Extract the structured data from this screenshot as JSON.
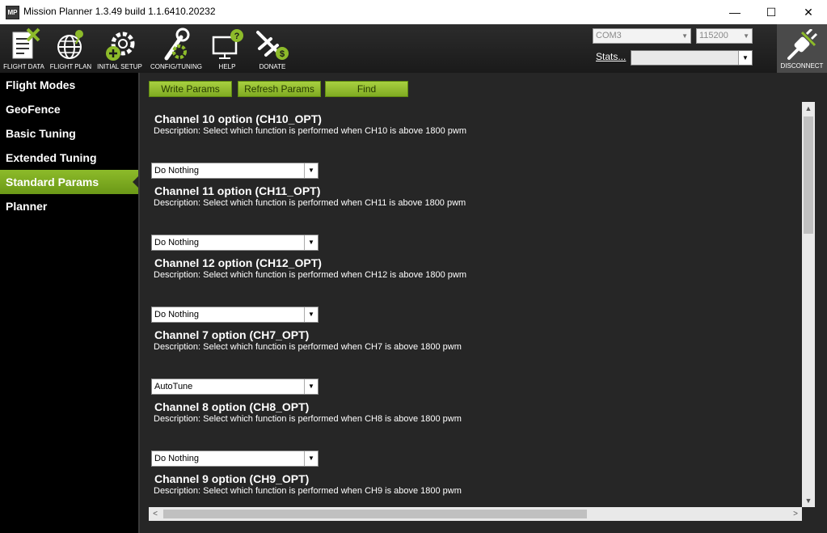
{
  "window": {
    "title": "Mission Planner 1.3.49 build 1.1.6410.20232",
    "app_icon": "MP",
    "controls": {
      "minimize": "—",
      "maximize": "☐",
      "close": "✕"
    }
  },
  "toolbar": {
    "buttons": [
      {
        "label": "FLIGHT DATA",
        "icon": "flight-data-icon"
      },
      {
        "label": "FLIGHT PLAN",
        "icon": "globe-icon"
      },
      {
        "label": "INITIAL SETUP",
        "icon": "gear-plus-icon"
      },
      {
        "label": "CONFIG/TUNING",
        "icon": "wrench-gear-icon"
      },
      {
        "label": "HELP",
        "icon": "monitor-question-icon"
      },
      {
        "label": "DONATE",
        "icon": "plane-dollar-icon"
      }
    ],
    "port": "COM3",
    "baud": "115200",
    "stats_label": "Stats...",
    "stats_value": "",
    "disconnect_label": "DISCONNECT"
  },
  "sidebar": {
    "items": [
      {
        "label": "Flight Modes",
        "active": false
      },
      {
        "label": "GeoFence",
        "active": false
      },
      {
        "label": "Basic Tuning",
        "active": false
      },
      {
        "label": "Extended Tuning",
        "active": false
      },
      {
        "label": "Standard Params",
        "active": true
      },
      {
        "label": "Planner",
        "active": false
      }
    ]
  },
  "actions": {
    "write": "Write Params",
    "refresh": "Refresh Params",
    "find": "Find"
  },
  "params": [
    {
      "title": "Channel 10 option (CH10_OPT)",
      "description": "Description: Select which function is performed when CH10 is above 1800 pwm",
      "value": "Do Nothing"
    },
    {
      "title": "Channel 11 option (CH11_OPT)",
      "description": "Description: Select which function is performed when CH11 is above 1800 pwm",
      "value": "Do Nothing"
    },
    {
      "title": "Channel 12 option (CH12_OPT)",
      "description": "Description: Select which function is performed when CH12 is above 1800 pwm",
      "value": "Do Nothing"
    },
    {
      "title": "Channel 7 option (CH7_OPT)",
      "description": "Description: Select which function is performed when CH7 is above 1800 pwm",
      "value": "AutoTune"
    },
    {
      "title": "Channel 8 option (CH8_OPT)",
      "description": "Description: Select which function is performed when CH8 is above 1800 pwm",
      "value": "Do Nothing"
    },
    {
      "title": "Channel 9 option (CH9_OPT)",
      "description": "Description: Select which function is performed when CH9 is above 1800 pwm",
      "value": ""
    }
  ],
  "colors": {
    "accent_green": "#8dbb2a",
    "sidebar_bg": "#000000",
    "content_bg": "#262626"
  }
}
